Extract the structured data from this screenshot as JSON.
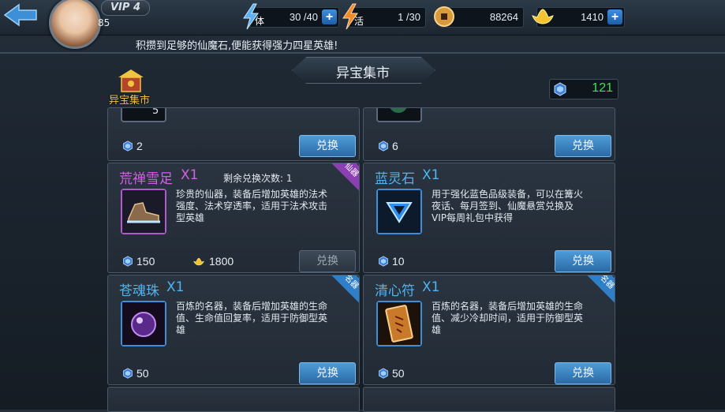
{
  "header": {
    "vip_label": "VIP 4",
    "level": "85",
    "stamina": {
      "label": "体",
      "value": "30 /40"
    },
    "activity": {
      "label": "活",
      "value": "1 /30"
    },
    "coins": "88264",
    "ingots": "1410",
    "ticker": "积攒到足够的仙魔石,便能获得强力四星英雄!"
  },
  "shop": {
    "title": "异宝集市",
    "label": "异宝集市",
    "balance": "121"
  },
  "items": [
    {
      "name": "",
      "qty": "5",
      "price": "2",
      "btn": "兑换"
    },
    {
      "name": "",
      "qty": "",
      "price": "6",
      "btn": "兑换"
    },
    {
      "name": "荒禅雪足",
      "qty": "X1",
      "remaining": "剩余兑换次数: 1",
      "badge": "仙器",
      "desc": "珍贵的仙器，装备后增加英雄的法术强度、法术穿透率，适用于法术攻击型英雄",
      "price": "150",
      "price2": "1800",
      "btn": "兑换",
      "name_color": "#d65de8"
    },
    {
      "name": "蓝灵石",
      "qty": "X1",
      "desc": "用于强化蓝色品级装备，可以在篝火夜话、每月签到、仙魔悬赏兑换及VIP每周礼包中获得",
      "price": "10",
      "btn": "兑换",
      "name_color": "#4db6f2"
    },
    {
      "name": "苍魂珠",
      "qty": "X1",
      "badge": "名器",
      "desc": "百炼的名器，装备后增加英雄的生命值、生命值回复率，适用于防御型英雄",
      "price": "50",
      "btn": "兑换",
      "name_color": "#4db6f2"
    },
    {
      "name": "清心符",
      "qty": "X1",
      "badge": "名器",
      "desc": "百炼的名器，装备后增加英雄的生命值、减少冷却时间，适用于防御型英雄",
      "price": "50",
      "btn": "兑换",
      "name_color": "#4db6f2"
    }
  ]
}
